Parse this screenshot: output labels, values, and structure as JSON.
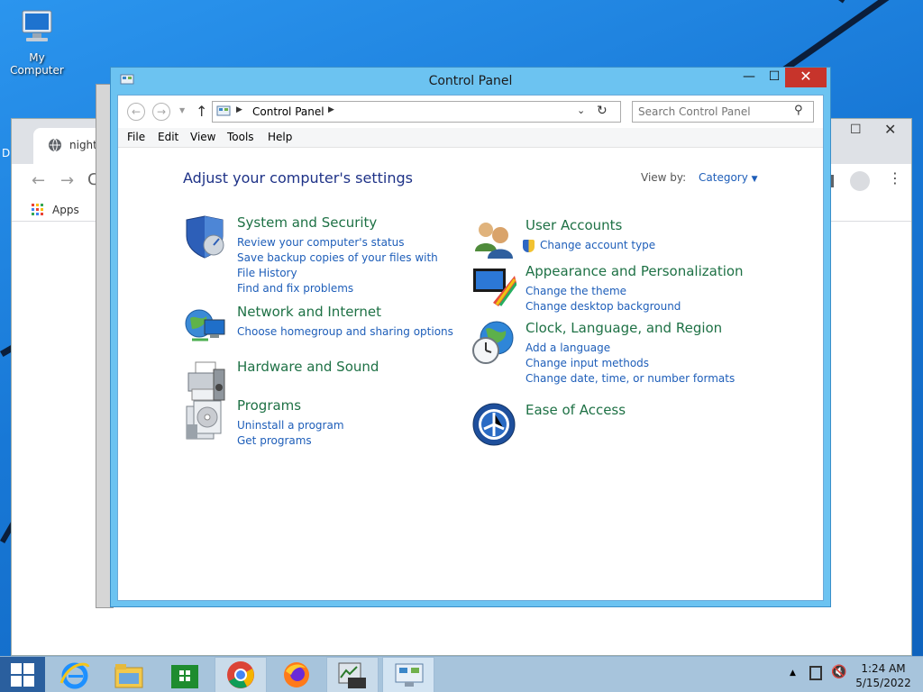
{
  "desktop": {
    "my_computer_label": "My Computer",
    "stray_label": "D"
  },
  "browser": {
    "tab_title": "nightly.l",
    "bookmarks_apps": "Apps"
  },
  "control_panel": {
    "title": "Control Panel",
    "breadcrumb": "Control Panel",
    "search_placeholder": "Search Control Panel",
    "menu": [
      "File",
      "Edit",
      "View",
      "Tools",
      "Help"
    ],
    "heading": "Adjust your computer's settings",
    "view_by_label": "View by:",
    "view_by_value": "Category",
    "categories": [
      {
        "title": "System and Security",
        "links": [
          "Review your computer's status",
          "Save backup copies of your files with File History",
          "Find and fix problems"
        ]
      },
      {
        "title": "Network and Internet",
        "links": [
          "Choose homegroup and sharing options"
        ]
      },
      {
        "title": "Hardware and Sound",
        "links": []
      },
      {
        "title": "Programs",
        "links": [
          "Uninstall a program",
          "Get programs"
        ]
      },
      {
        "title": "User Accounts",
        "links": [
          "Change account type"
        ]
      },
      {
        "title": "Appearance and Personalization",
        "links": [
          "Change the theme",
          "Change desktop background"
        ]
      },
      {
        "title": "Clock, Language, and Region",
        "links": [
          "Add a language",
          "Change input methods",
          "Change date, time, or number formats"
        ]
      },
      {
        "title": "Ease of Access",
        "links": []
      }
    ]
  },
  "taskbar": {
    "time": "1:24 AM",
    "date": "5/15/2022"
  },
  "colors": {
    "category_title": "#1e7145",
    "link": "#1e5eb9",
    "heading": "#1e3287",
    "close_button": "#c7342b"
  }
}
